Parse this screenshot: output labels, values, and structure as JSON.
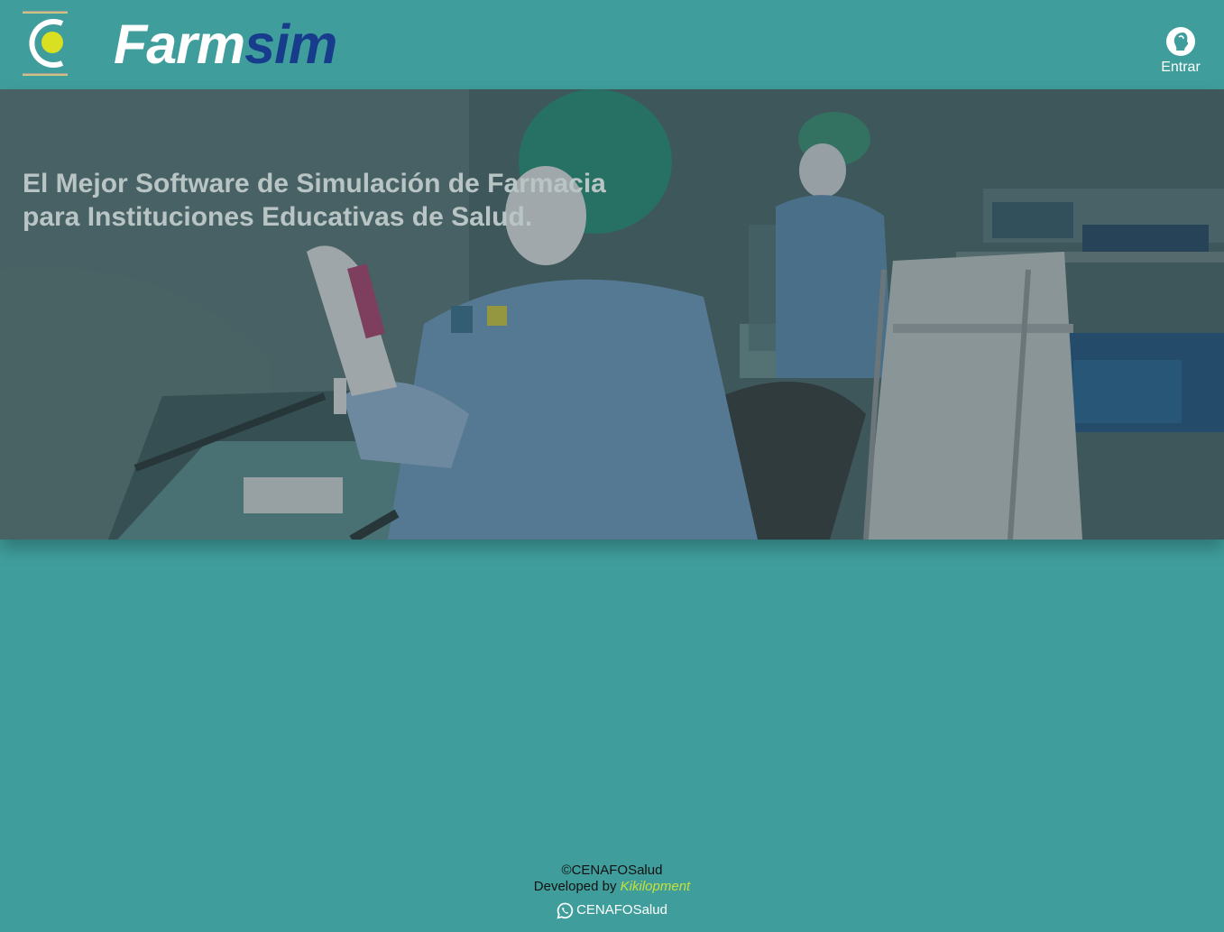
{
  "header": {
    "brand_part1": "Farm",
    "brand_part2": "sim",
    "login_label": "Entrar"
  },
  "hero": {
    "title_line1": "El Mejor Software de Simulación de Farmacia",
    "title_line2": "para Instituciones Educativas de Salud."
  },
  "footer": {
    "copyright": "©CENAFOSalud",
    "developed_by": "Developed by ",
    "developer": "Kikilopment",
    "whatsapp_label": "CENAFOSalud"
  },
  "colors": {
    "background": "#3f9e9c",
    "brand_accent": "#173c8c",
    "logo_dot": "#d8e021",
    "developer_link": "#c6e03a"
  }
}
